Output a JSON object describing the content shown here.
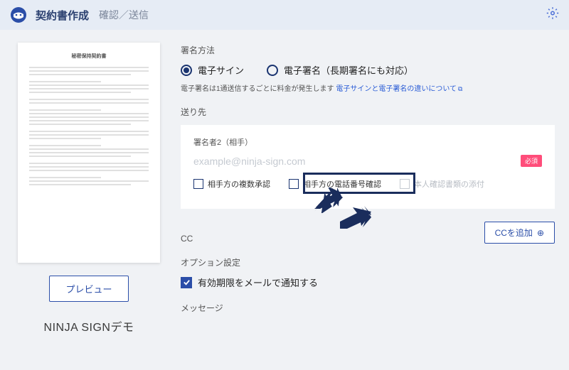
{
  "header": {
    "title": "契約書作成",
    "subtitle": "確認／送信"
  },
  "left": {
    "doc_title": "秘密保持契約書",
    "preview_btn": "プレビュー",
    "brand": "NINJA SIGNデモ"
  },
  "main": {
    "sign_method_label": "署名方法",
    "radio_esign": "電子サイン",
    "radio_esig": "電子署名（長期署名にも対応）",
    "help_text_prefix": "電子署名は1通送信するごとに料金が発生します ",
    "help_link": "電子サインと電子署名の違いについて",
    "recipient_label": "送り先",
    "signer_label": "署名者2（相手）",
    "email_placeholder": "example@ninja-sign.com",
    "required_badge": "必須",
    "cb_multi_approve": "相手方の複数承認",
    "cb_phone_verify": "相手方の電話番号確認",
    "cb_id_attach": "本人確認書類の添付",
    "cc_label": "CC",
    "cc_btn": "CCを追加",
    "option_label": "オプション設定",
    "option_notify": "有効期限をメールで通知する",
    "message_label": "メッセージ"
  }
}
